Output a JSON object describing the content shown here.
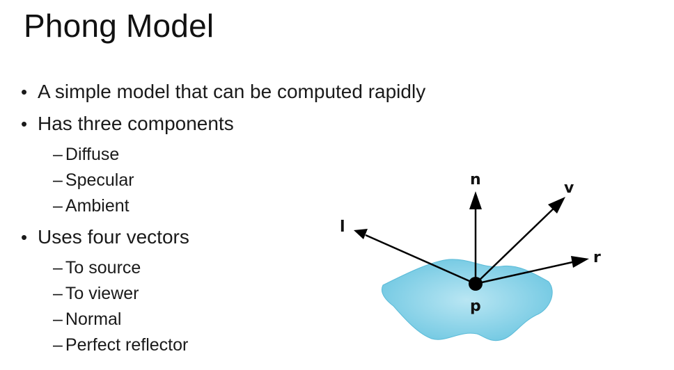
{
  "slide": {
    "title": "Phong Model"
  },
  "bullets": [
    {
      "text": "A simple model that can be computed rapidly",
      "subs": []
    },
    {
      "text": "Has three components",
      "subs": [
        "Diffuse",
        "Specular",
        "Ambient"
      ]
    },
    {
      "text": "Uses four vectors",
      "subs": [
        "To source",
        "To viewer",
        "Normal",
        "Perfect reflector"
      ]
    }
  ],
  "diagram": {
    "labels": {
      "normal": "n",
      "viewer": "v",
      "source": "l",
      "reflector": "r",
      "point": "p"
    },
    "colors": {
      "surface_fill": "#7fcfe6",
      "surface_edge": "#5bbbd8",
      "vector": "#000000"
    }
  }
}
